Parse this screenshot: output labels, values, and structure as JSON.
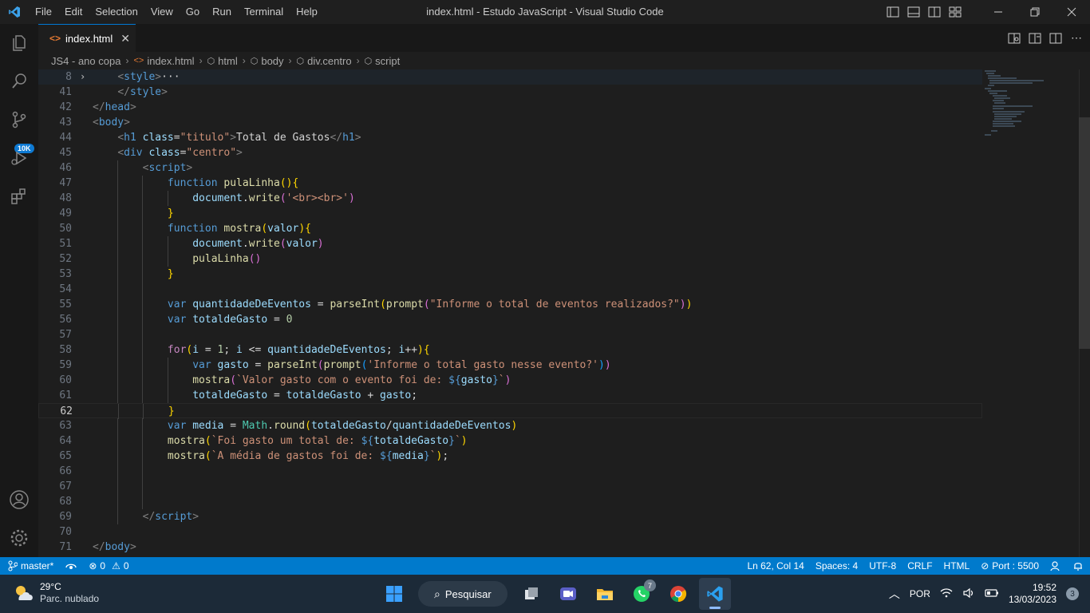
{
  "window": {
    "title": "index.html - Estudo JavaScript - Visual Studio Code"
  },
  "menu": [
    "File",
    "Edit",
    "Selection",
    "View",
    "Go",
    "Run",
    "Terminal",
    "Help"
  ],
  "activity_bar": {
    "source_control_badge": "10K"
  },
  "tab": {
    "label": "index.html"
  },
  "breadcrumbs": [
    "JS4 - ano copa",
    "index.html",
    "html",
    "body",
    "div.centro",
    "script"
  ],
  "editor": {
    "active_line": "62",
    "lines": [
      {
        "n": "8",
        "segs": [
          [
            "    ",
            "t-txt"
          ],
          [
            "<",
            "t-br"
          ],
          [
            "style",
            "t-tag"
          ],
          [
            ">",
            "t-br"
          ],
          [
            "···",
            "t-txt"
          ]
        ]
      },
      {
        "n": "41",
        "segs": [
          [
            "    ",
            "t-txt"
          ],
          [
            "</",
            "t-br"
          ],
          [
            "style",
            "t-tag"
          ],
          [
            ">",
            "t-br"
          ]
        ]
      },
      {
        "n": "42",
        "segs": [
          [
            "</",
            "t-br"
          ],
          [
            "head",
            "t-tag"
          ],
          [
            ">",
            "t-br"
          ]
        ]
      },
      {
        "n": "43",
        "segs": [
          [
            "<",
            "t-br"
          ],
          [
            "body",
            "t-tag"
          ],
          [
            ">",
            "t-br"
          ]
        ]
      },
      {
        "n": "44",
        "segs": [
          [
            "    ",
            "t-txt"
          ],
          [
            "<",
            "t-br"
          ],
          [
            "h1",
            "t-tag"
          ],
          [
            " ",
            "t-txt"
          ],
          [
            "class",
            "t-attr"
          ],
          [
            "=",
            "t-txt"
          ],
          [
            "\"titulo\"",
            "t-str"
          ],
          [
            ">",
            "t-br"
          ],
          [
            "Total de Gastos",
            "t-txt"
          ],
          [
            "</",
            "t-br"
          ],
          [
            "h1",
            "t-tag"
          ],
          [
            ">",
            "t-br"
          ]
        ]
      },
      {
        "n": "45",
        "segs": [
          [
            "    ",
            "t-txt"
          ],
          [
            "<",
            "t-br"
          ],
          [
            "div",
            "t-tag"
          ],
          [
            " ",
            "t-txt"
          ],
          [
            "class",
            "t-attr"
          ],
          [
            "=",
            "t-txt"
          ],
          [
            "\"centro\"",
            "t-str"
          ],
          [
            ">",
            "t-br"
          ]
        ]
      },
      {
        "n": "46",
        "segs": [
          [
            "        ",
            "t-txt"
          ],
          [
            "<",
            "t-br"
          ],
          [
            "script",
            "t-tag"
          ],
          [
            ">",
            "t-br"
          ]
        ]
      },
      {
        "n": "47",
        "segs": [
          [
            "            ",
            "t-txt"
          ],
          [
            "function",
            "t-kw"
          ],
          [
            " ",
            "t-txt"
          ],
          [
            "pulaLinha",
            "t-fn"
          ],
          [
            "()",
            "t-p1"
          ],
          [
            "{",
            "t-p1"
          ]
        ]
      },
      {
        "n": "48",
        "segs": [
          [
            "                ",
            "t-txt"
          ],
          [
            "document",
            "t-var"
          ],
          [
            ".",
            "t-txt"
          ],
          [
            "write",
            "t-fn"
          ],
          [
            "(",
            "t-p2"
          ],
          [
            "'<br><br>'",
            "t-str"
          ],
          [
            ")",
            "t-p2"
          ]
        ]
      },
      {
        "n": "49",
        "segs": [
          [
            "            ",
            "t-txt"
          ],
          [
            "}",
            "t-p1"
          ]
        ]
      },
      {
        "n": "50",
        "segs": [
          [
            "            ",
            "t-txt"
          ],
          [
            "function",
            "t-kw"
          ],
          [
            " ",
            "t-txt"
          ],
          [
            "mostra",
            "t-fn"
          ],
          [
            "(",
            "t-p1"
          ],
          [
            "valor",
            "t-var"
          ],
          [
            ")",
            "t-p1"
          ],
          [
            "{",
            "t-p1"
          ]
        ]
      },
      {
        "n": "51",
        "segs": [
          [
            "                ",
            "t-txt"
          ],
          [
            "document",
            "t-var"
          ],
          [
            ".",
            "t-txt"
          ],
          [
            "write",
            "t-fn"
          ],
          [
            "(",
            "t-p2"
          ],
          [
            "valor",
            "t-var"
          ],
          [
            ")",
            "t-p2"
          ]
        ]
      },
      {
        "n": "52",
        "segs": [
          [
            "                ",
            "t-txt"
          ],
          [
            "pulaLinha",
            "t-fn"
          ],
          [
            "()",
            "t-p2"
          ]
        ]
      },
      {
        "n": "53",
        "segs": [
          [
            "            ",
            "t-txt"
          ],
          [
            "}",
            "t-p1"
          ]
        ]
      },
      {
        "n": "54",
        "segs": []
      },
      {
        "n": "55",
        "segs": [
          [
            "            ",
            "t-txt"
          ],
          [
            "var",
            "t-kw"
          ],
          [
            " ",
            "t-txt"
          ],
          [
            "quantidadeDeEventos",
            "t-var"
          ],
          [
            " = ",
            "t-txt"
          ],
          [
            "parseInt",
            "t-fn"
          ],
          [
            "(",
            "t-p1"
          ],
          [
            "prompt",
            "t-fn"
          ],
          [
            "(",
            "t-p2"
          ],
          [
            "\"Informe o total de eventos realizados?\"",
            "t-str"
          ],
          [
            ")",
            "t-p2"
          ],
          [
            ")",
            "t-p1"
          ]
        ]
      },
      {
        "n": "56",
        "segs": [
          [
            "            ",
            "t-txt"
          ],
          [
            "var",
            "t-kw"
          ],
          [
            " ",
            "t-txt"
          ],
          [
            "totaldeGasto",
            "t-var"
          ],
          [
            " = ",
            "t-txt"
          ],
          [
            "0",
            "t-num"
          ]
        ]
      },
      {
        "n": "57",
        "segs": []
      },
      {
        "n": "58",
        "segs": [
          [
            "            ",
            "t-txt"
          ],
          [
            "for",
            "t-ctrl"
          ],
          [
            "(",
            "t-p1"
          ],
          [
            "i",
            "t-var"
          ],
          [
            " = ",
            "t-txt"
          ],
          [
            "1",
            "t-num"
          ],
          [
            "; ",
            "t-txt"
          ],
          [
            "i",
            "t-var"
          ],
          [
            " <= ",
            "t-txt"
          ],
          [
            "quantidadeDeEventos",
            "t-var"
          ],
          [
            "; ",
            "t-txt"
          ],
          [
            "i",
            "t-var"
          ],
          [
            "++",
            "t-txt"
          ],
          [
            ")",
            "t-p1"
          ],
          [
            "{",
            "t-p1"
          ]
        ]
      },
      {
        "n": "59",
        "segs": [
          [
            "                ",
            "t-txt"
          ],
          [
            "var",
            "t-kw"
          ],
          [
            " ",
            "t-txt"
          ],
          [
            "gasto",
            "t-var"
          ],
          [
            " = ",
            "t-txt"
          ],
          [
            "parseInt",
            "t-fn"
          ],
          [
            "(",
            "t-p2"
          ],
          [
            "prompt",
            "t-fn"
          ],
          [
            "(",
            "t-p3"
          ],
          [
            "'Informe o total gasto nesse evento?'",
            "t-str"
          ],
          [
            ")",
            "t-p3"
          ],
          [
            ")",
            "t-p2"
          ]
        ]
      },
      {
        "n": "60",
        "segs": [
          [
            "                ",
            "t-txt"
          ],
          [
            "mostra",
            "t-fn"
          ],
          [
            "(",
            "t-p2"
          ],
          [
            "`Valor gasto com o evento foi de: ",
            "t-str"
          ],
          [
            "${",
            "t-kw"
          ],
          [
            "gasto",
            "t-var"
          ],
          [
            "}",
            "t-kw"
          ],
          [
            "`",
            "t-str"
          ],
          [
            ")",
            "t-p2"
          ]
        ]
      },
      {
        "n": "61",
        "segs": [
          [
            "                ",
            "t-txt"
          ],
          [
            "totaldeGasto",
            "t-var"
          ],
          [
            " = ",
            "t-txt"
          ],
          [
            "totaldeGasto",
            "t-var"
          ],
          [
            " + ",
            "t-txt"
          ],
          [
            "gasto",
            "t-var"
          ],
          [
            ";",
            "t-txt"
          ]
        ]
      },
      {
        "n": "62",
        "segs": [
          [
            "            ",
            "t-txt"
          ],
          [
            "}",
            "t-p1"
          ]
        ]
      },
      {
        "n": "63",
        "segs": [
          [
            "            ",
            "t-txt"
          ],
          [
            "var",
            "t-kw"
          ],
          [
            " ",
            "t-txt"
          ],
          [
            "media",
            "t-var"
          ],
          [
            " = ",
            "t-txt"
          ],
          [
            "Math",
            "t-cls"
          ],
          [
            ".",
            "t-txt"
          ],
          [
            "round",
            "t-fn"
          ],
          [
            "(",
            "t-p1"
          ],
          [
            "totaldeGasto",
            "t-var"
          ],
          [
            "/",
            "t-txt"
          ],
          [
            "quantidadeDeEventos",
            "t-var"
          ],
          [
            ")",
            "t-p1"
          ]
        ]
      },
      {
        "n": "64",
        "segs": [
          [
            "            ",
            "t-txt"
          ],
          [
            "mostra",
            "t-fn"
          ],
          [
            "(",
            "t-p1"
          ],
          [
            "`Foi gasto um total de: ",
            "t-str"
          ],
          [
            "${",
            "t-kw"
          ],
          [
            "totaldeGasto",
            "t-var"
          ],
          [
            "}",
            "t-kw"
          ],
          [
            "`",
            "t-str"
          ],
          [
            ")",
            "t-p1"
          ]
        ]
      },
      {
        "n": "65",
        "segs": [
          [
            "            ",
            "t-txt"
          ],
          [
            "mostra",
            "t-fn"
          ],
          [
            "(",
            "t-p1"
          ],
          [
            "`A média de gastos foi de: ",
            "t-str"
          ],
          [
            "${",
            "t-kw"
          ],
          [
            "media",
            "t-var"
          ],
          [
            "}",
            "t-kw"
          ],
          [
            "`",
            "t-str"
          ],
          [
            ")",
            "t-p1"
          ],
          [
            ";",
            "t-txt"
          ]
        ]
      },
      {
        "n": "66",
        "segs": []
      },
      {
        "n": "67",
        "segs": []
      },
      {
        "n": "68",
        "segs": []
      },
      {
        "n": "69",
        "segs": [
          [
            "        ",
            "t-txt"
          ],
          [
            "</",
            "t-br"
          ],
          [
            "script",
            "t-tag"
          ],
          [
            ">",
            "t-br"
          ]
        ]
      },
      {
        "n": "70",
        "segs": []
      },
      {
        "n": "71",
        "segs": [
          [
            "</",
            "t-br"
          ],
          [
            "body",
            "t-tag"
          ],
          [
            ">",
            "t-br"
          ]
        ]
      }
    ]
  },
  "status_bar": {
    "branch": "master*",
    "errors": "0",
    "warnings": "0",
    "cursor": "Ln 62, Col 14",
    "spaces": "Spaces: 4",
    "encoding": "UTF-8",
    "eol": "CRLF",
    "language": "HTML",
    "port": "Port : 5500"
  },
  "taskbar": {
    "temperature": "29°C",
    "weather": "Parc. nublado",
    "search_label": "Pesquisar",
    "whatsapp_badge": "7",
    "language": "POR",
    "time": "19:52",
    "date": "13/03/2023",
    "notifications": "3"
  }
}
